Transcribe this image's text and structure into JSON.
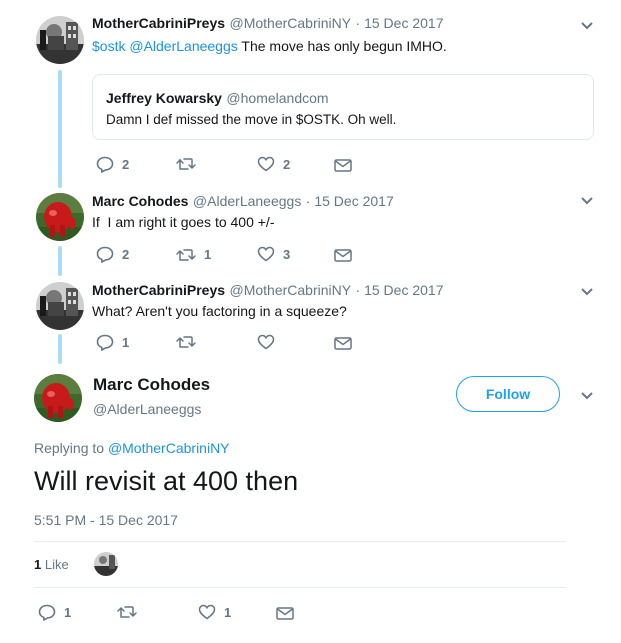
{
  "tweets": [
    {
      "name": "MotherCabriniPreys",
      "handle": "@MotherCabriniNY",
      "date": "· 15 Dec 2017",
      "text_links": "$ostk @AlderLaneeggs",
      "text_body": " The move has only begun IMHO.",
      "quote": {
        "name": "Jeffrey Kowarsky",
        "handle": "@homelandcom",
        "text": "Damn I def missed the move in $OSTK. Oh well."
      },
      "replies": "2",
      "retweets": "",
      "likes": "2"
    },
    {
      "name": "Marc Cohodes",
      "handle": "@AlderLaneeggs",
      "date": "· 15 Dec 2017",
      "text": "If  I am right it goes to 400 +/-",
      "replies": "2",
      "retweets": "1",
      "likes": "3"
    },
    {
      "name": "MotherCabriniPreys",
      "handle": "@MotherCabriniNY",
      "date": "· 15 Dec 2017",
      "text": "What? Aren't you factoring in a squeeze?",
      "replies": "1",
      "retweets": "",
      "likes": ""
    }
  ],
  "main": {
    "name": "Marc Cohodes",
    "handle": "@AlderLaneeggs",
    "follow_label": "Follow",
    "replying_prefix": "Replying to ",
    "replying_to": "@MotherCabriniNY",
    "text": "Will revisit at 400 then",
    "timestamp": "5:51 PM - 15 Dec 2017",
    "likes_count": "1",
    "likes_label": "Like",
    "replies": "1",
    "retweets": "",
    "likes": "1"
  },
  "colors": {
    "accent": "#1da1f2",
    "link": "#1b95e0",
    "muted": "#657786",
    "thread": "#a8dcf7"
  }
}
